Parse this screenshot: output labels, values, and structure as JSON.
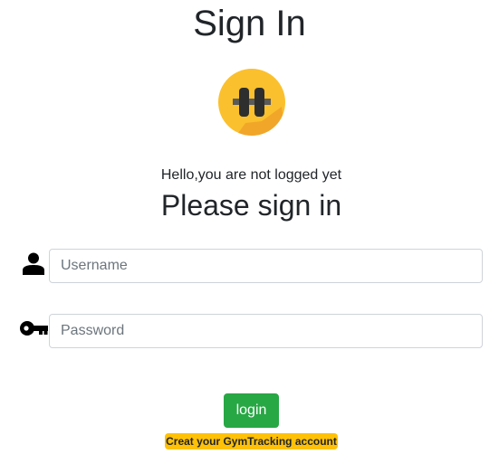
{
  "page": {
    "title": "Sign In",
    "greeting": "Hello,you are not logged yet",
    "subtitle": "Please sign in"
  },
  "logo": {
    "icon": "dumbbell-icon",
    "colors": {
      "circle": "#fbc02d",
      "shadow": "#f39c12",
      "weights": "#2e2e2e"
    }
  },
  "form": {
    "username": {
      "icon": "user-icon",
      "placeholder": "Username",
      "value": ""
    },
    "password": {
      "icon": "key-icon",
      "placeholder": "Password",
      "value": ""
    },
    "login_label": "login",
    "create_account_label": "Creat your GymTracking account"
  },
  "colors": {
    "login_button": "#28a745",
    "create_account_badge": "#ffc107",
    "text": "#212529"
  }
}
